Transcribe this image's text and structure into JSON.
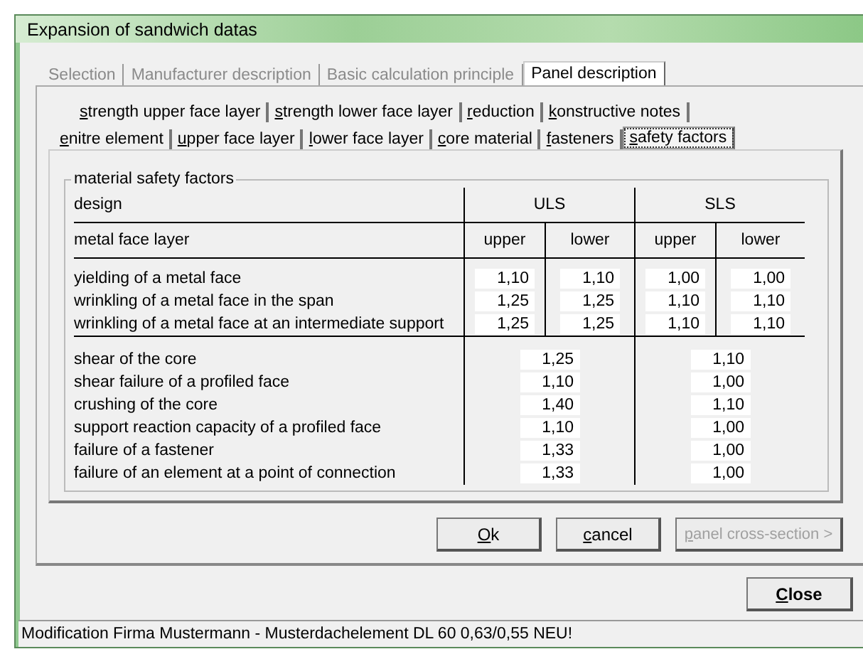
{
  "window": {
    "title": "Expansion of sandwich datas"
  },
  "main_tabs": [
    {
      "label": "Selection",
      "selected": false,
      "disabled": true
    },
    {
      "label": "Manufacturer description",
      "selected": false,
      "disabled": true
    },
    {
      "label": "Basic calculation principle",
      "selected": false,
      "disabled": true
    },
    {
      "label": "Panel description",
      "selected": true,
      "disabled": false
    }
  ],
  "sub_tabs_back": [
    {
      "label": "strength upper face layer",
      "selected": false
    },
    {
      "label": "strength lower face layer",
      "selected": false
    },
    {
      "label": "reduction",
      "selected": false
    },
    {
      "label": "konstructive notes",
      "selected": false
    }
  ],
  "sub_tabs_front": [
    {
      "label": "enitre element",
      "selected": false
    },
    {
      "label": "upper face layer",
      "selected": false
    },
    {
      "label": "lower face layer",
      "selected": false
    },
    {
      "label": "core material",
      "selected": false
    },
    {
      "label": "fasteners",
      "selected": false
    },
    {
      "label": "safety factors",
      "selected": true
    }
  ],
  "group": {
    "title": "material safety factors",
    "header": {
      "design_label": "design",
      "uls": "ULS",
      "sls": "SLS",
      "layer_label": "metal face layer",
      "columns": [
        "upper",
        "lower",
        "upper",
        "lower"
      ]
    },
    "face_rows": [
      {
        "label": "yielding of a metal face",
        "values": [
          "1,10",
          "1,10",
          "1,00",
          "1,00"
        ]
      },
      {
        "label": "wrinkling of a metal face in the span",
        "values": [
          "1,25",
          "1,25",
          "1,10",
          "1,10"
        ]
      },
      {
        "label": "wrinkling of a metal face at an intermediate support",
        "values": [
          "1,25",
          "1,25",
          "1,10",
          "1,10"
        ]
      }
    ],
    "core_rows": [
      {
        "label": "shear of the core",
        "uls": "1,25",
        "sls": "1,10"
      },
      {
        "label": "shear failure of a profiled face",
        "uls": "1,10",
        "sls": "1,00"
      },
      {
        "label": "crushing of the core",
        "uls": "1,40",
        "sls": "1,10"
      },
      {
        "label": "support reaction capacity of a profiled face",
        "uls": "1,10",
        "sls": "1,00"
      },
      {
        "label": "failure of a fastener",
        "uls": "1,33",
        "sls": "1,00"
      },
      {
        "label": "failure of an element at a point of connection",
        "uls": "1,33",
        "sls": "1,00"
      }
    ]
  },
  "buttons": [
    {
      "label": "Ok",
      "disabled": false
    },
    {
      "label": "cancel",
      "disabled": false
    },
    {
      "label": "panel cross-section >",
      "disabled": true
    }
  ],
  "close_button": {
    "label": "Close"
  },
  "status_bar": "Modification Firma Mustermann - Musterdachelement DL 60 0,63/0,55 NEU!"
}
